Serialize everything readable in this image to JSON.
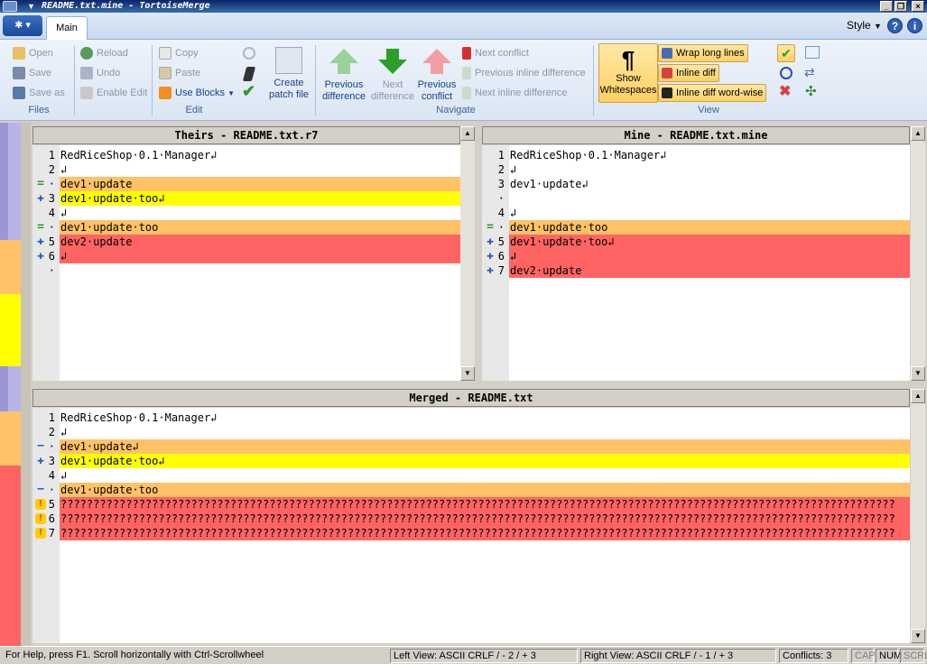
{
  "window": {
    "title": "README.txt.mine - TortoiseMerge"
  },
  "tabs": {
    "main": "Main",
    "style": "Style"
  },
  "ribbon": {
    "files": {
      "open": "Open",
      "save": "Save",
      "save_as": "Save as",
      "label": "Files"
    },
    "edit": {
      "reload": "Reload",
      "undo": "Undo",
      "enable_edit": "Enable Edit",
      "copy": "Copy",
      "paste": "Paste",
      "use_blocks": "Use Blocks",
      "create_patch": "Create patch file",
      "label": "Edit"
    },
    "navigate": {
      "prev_diff": "Previous difference",
      "next_diff": "Next difference",
      "prev_conflict": "Previous conflict",
      "next_conflict": "Next conflict",
      "prev_inline": "Previous inline difference",
      "next_inline": "Next inline difference",
      "label": "Navigate"
    },
    "view": {
      "show_ws": "Show Whitespaces",
      "wrap": "Wrap long lines",
      "inline_diff": "Inline diff",
      "inline_word": "Inline diff word-wise",
      "label": "View"
    }
  },
  "left": {
    "header": "Theirs - README.txt.r7",
    "lines": [
      {
        "num": "1",
        "text": "RedRiceShop·0.1·Manager↲",
        "cls": "",
        "mk": ""
      },
      {
        "num": "2",
        "text": "↲",
        "cls": "",
        "mk": ""
      },
      {
        "num": "·",
        "text": "dev1·update",
        "cls": "orange",
        "mk": "eq"
      },
      {
        "num": "3",
        "text": "dev1·update·too↲",
        "cls": "yellow",
        "mk": "plus"
      },
      {
        "num": "4",
        "text": "↲",
        "cls": "",
        "mk": ""
      },
      {
        "num": "·",
        "text": "dev1·update·too",
        "cls": "orange",
        "mk": "eq"
      },
      {
        "num": "5",
        "text": "dev2·update",
        "cls": "red",
        "mk": "plus"
      },
      {
        "num": "6",
        "text": "↲",
        "cls": "red",
        "mk": "plus"
      },
      {
        "num": "·",
        "text": "",
        "cls": "red",
        "mk": ""
      }
    ]
  },
  "right": {
    "header": "Mine - README.txt.mine",
    "lines": [
      {
        "num": "1",
        "text": "RedRiceShop·0.1·Manager↲",
        "cls": "",
        "mk": ""
      },
      {
        "num": "2",
        "text": "↲",
        "cls": "",
        "mk": ""
      },
      {
        "num": "3",
        "text": "dev1·update↲",
        "cls": "",
        "mk": ""
      },
      {
        "num": "·",
        "text": "",
        "cls": "grey",
        "mk": ""
      },
      {
        "num": "4",
        "text": "↲",
        "cls": "",
        "mk": ""
      },
      {
        "num": "·",
        "text": "dev1·update·too",
        "cls": "orange",
        "mk": "eq"
      },
      {
        "num": "5",
        "text": "dev1·update·too↲",
        "cls": "red",
        "mk": "plus"
      },
      {
        "num": "6",
        "text": "↲",
        "cls": "red",
        "mk": "plus"
      },
      {
        "num": "7",
        "text": "dev2·update",
        "cls": "red",
        "mk": "plus"
      }
    ]
  },
  "merged": {
    "header": "Merged - README.txt",
    "lines": [
      {
        "num": "1",
        "text": "RedRiceShop·0.1·Manager↲",
        "cls": "",
        "mk": ""
      },
      {
        "num": "2",
        "text": "↲",
        "cls": "",
        "mk": ""
      },
      {
        "num": "·",
        "text": "dev1·update↲",
        "cls": "orange",
        "mk": "minus"
      },
      {
        "num": "3",
        "text": "dev1·update·too↲",
        "cls": "yellow",
        "mk": "plus"
      },
      {
        "num": "4",
        "text": "↲",
        "cls": "",
        "mk": ""
      },
      {
        "num": "·",
        "text": "dev1·update·too",
        "cls": "orange",
        "mk": "minus"
      },
      {
        "num": "5",
        "text": "????????????????????????????????????????????????????????????????????????????????????????????????????????????????????????????????",
        "cls": "red",
        "mk": "conflict"
      },
      {
        "num": "6",
        "text": "????????????????????????????????????????????????????????????????????????????????????????????????????????????????????????????????",
        "cls": "red",
        "mk": "conflict"
      },
      {
        "num": "7",
        "text": "????????????????????????????????????????????????????????????????????????????????????????????????????????????????????????????????",
        "cls": "red",
        "mk": "conflict"
      }
    ]
  },
  "status": {
    "help": "For Help, press F1. Scroll horizontally with Ctrl-Scrollwheel",
    "left_view": "Left View: ASCII CRLF  / - 2 / + 3",
    "right_view": "Right View: ASCII CRLF  / - 1 / + 3",
    "conflicts": "Conflicts: 3",
    "cap": "CAP",
    "num": "NUM",
    "scrl": "SCRL"
  },
  "colors": {
    "orange": "#ffc266",
    "yellow": "#ffff00",
    "red": "#ff6464",
    "grey": "#c8c8c8"
  }
}
